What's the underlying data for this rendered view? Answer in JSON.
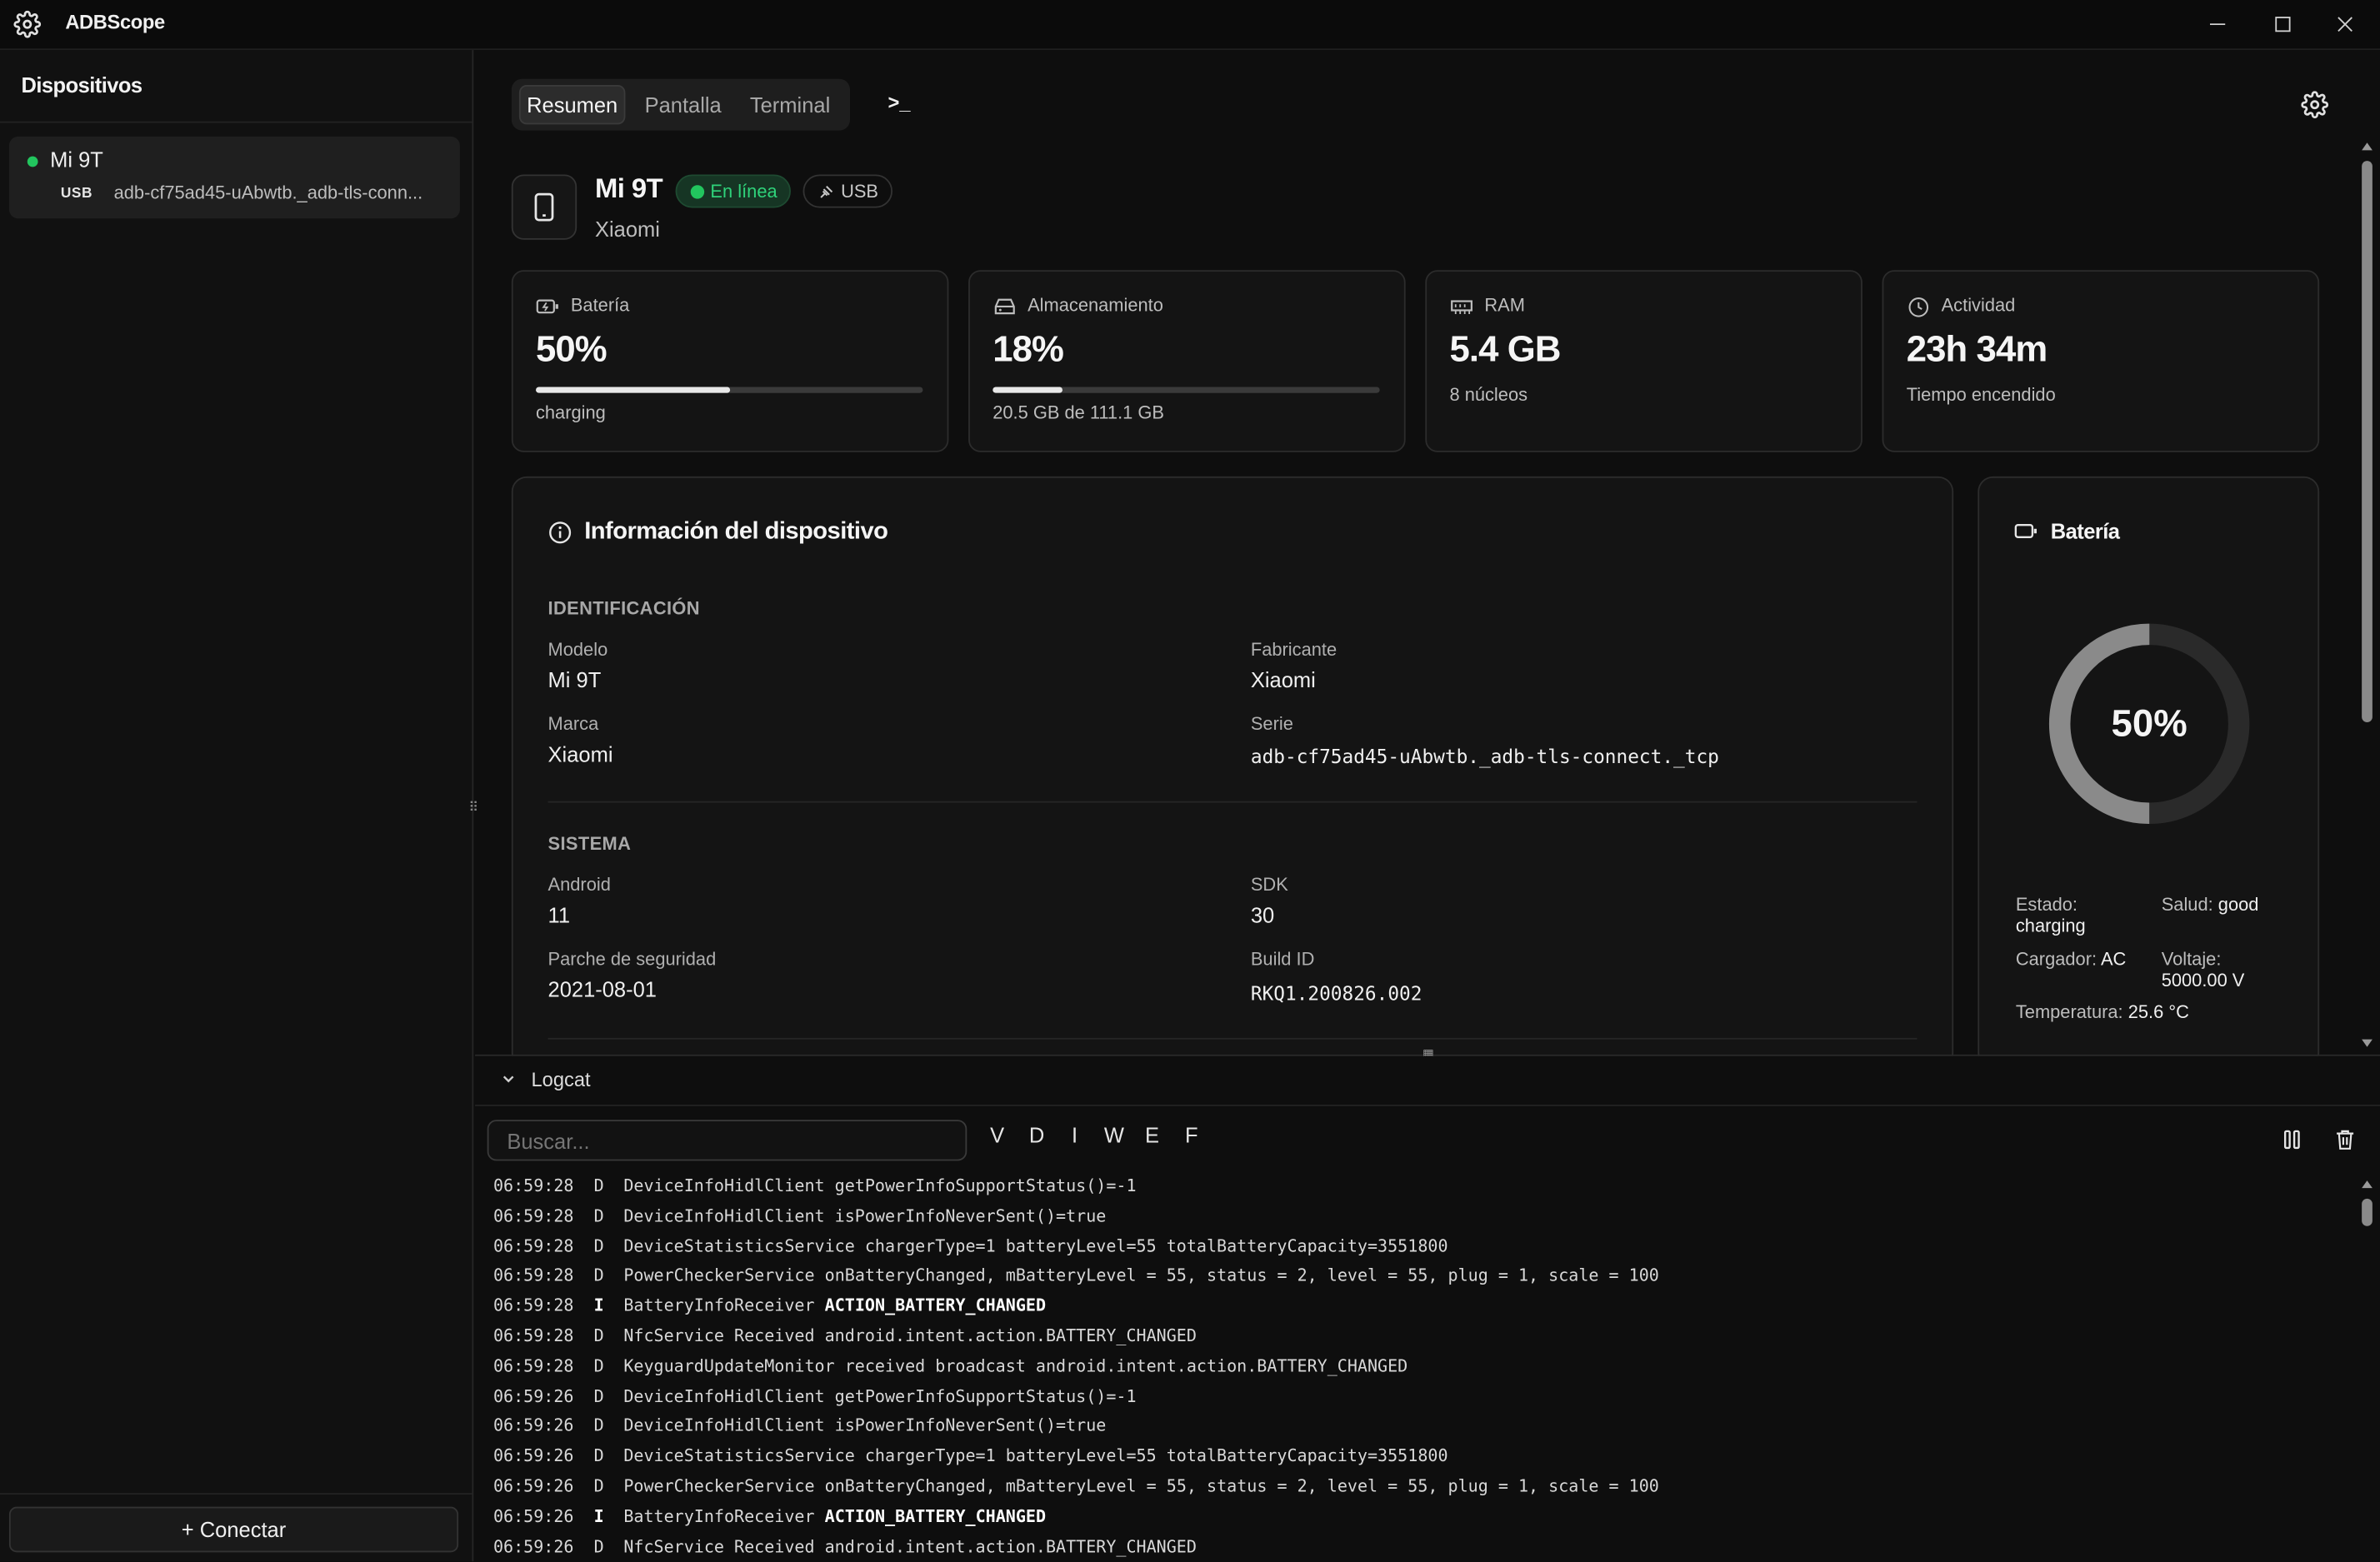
{
  "app": {
    "title": "ADBScope"
  },
  "sidebar": {
    "title": "Dispositivos",
    "device": {
      "name": "Mi 9T",
      "conn": "USB",
      "serial": "adb-cf75ad45-uAbwtb._adb-tls-conn..."
    },
    "connect_label": "+ Conectar"
  },
  "tabs": [
    "Resumen",
    "Pantalla",
    "Terminal"
  ],
  "terminal_glyph": ">_",
  "device": {
    "name": "Mi 9T",
    "status": "En línea",
    "conn": "USB",
    "brand": "Xiaomi"
  },
  "stats": {
    "battery": {
      "label": "Batería",
      "value": "50%",
      "fraction": 0.5,
      "sub": "charging"
    },
    "storage": {
      "label": "Almacenamiento",
      "value": "18%",
      "fraction": 0.18,
      "sub": "20.5 GB de 111.1 GB"
    },
    "ram": {
      "label": "RAM",
      "value": "5.4 GB",
      "sub": "8 núcleos"
    },
    "activity": {
      "label": "Actividad",
      "value": "23h 34m",
      "sub": "Tiempo encendido"
    }
  },
  "info": {
    "title": "Información del dispositivo",
    "ident_title": "IDENTIFICACIÓN",
    "model_label": "Modelo",
    "model": "Mi 9T",
    "maker_label": "Fabricante",
    "maker": "Xiaomi",
    "brand_label": "Marca",
    "brand": "Xiaomi",
    "serial_label": "Serie",
    "serial": "adb-cf75ad45-uAbwtb._adb-tls-connect._tcp",
    "system_title": "SISTEMA",
    "android_label": "Android",
    "android": "11",
    "sdk_label": "SDK",
    "sdk": "30",
    "patch_label": "Parche de seguridad",
    "patch": "2021-08-01",
    "build_label": "Build ID",
    "build": "RKQ1.200826.002"
  },
  "battery_panel": {
    "title": "Batería",
    "percent": "50%",
    "level": 0.5,
    "state_label": "Estado:",
    "state": "charging",
    "health_label": "Salud:",
    "health": "good",
    "charger_label": "Cargador:",
    "charger": "AC",
    "voltage_label": "Voltaje:",
    "voltage": "5000.00 V",
    "temp_label": "Temperatura:",
    "temp": "25.6 °C"
  },
  "logcat": {
    "title": "Logcat",
    "search_placeholder": "Buscar...",
    "levels": [
      "V",
      "D",
      "I",
      "W",
      "E",
      "F"
    ],
    "lines": [
      {
        "time": "06:59:28",
        "level": "D",
        "tag": "DeviceInfoHidlClient",
        "msg": "getPowerInfoSupportStatus()=-1",
        "bold": false
      },
      {
        "time": "06:59:28",
        "level": "D",
        "tag": "DeviceInfoHidlClient",
        "msg": "isPowerInfoNeverSent()=true",
        "bold": false
      },
      {
        "time": "06:59:28",
        "level": "D",
        "tag": "DeviceStatisticsService",
        "msg": "chargerType=1 batteryLevel=55 totalBatteryCapacity=3551800",
        "bold": false
      },
      {
        "time": "06:59:28",
        "level": "D",
        "tag": "PowerCheckerService",
        "msg": "onBatteryChanged, mBatteryLevel = 55, status = 2, level = 55, plug = 1, scale = 100",
        "bold": false
      },
      {
        "time": "06:59:28",
        "level": "I",
        "tag": "BatteryInfoReceiver",
        "msg": "ACTION_BATTERY_CHANGED",
        "bold": true
      },
      {
        "time": "06:59:28",
        "level": "D",
        "tag": "NfcService",
        "msg": "Received android.intent.action.BATTERY_CHANGED",
        "bold": false
      },
      {
        "time": "06:59:28",
        "level": "D",
        "tag": "KeyguardUpdateMonitor",
        "msg": "received broadcast android.intent.action.BATTERY_CHANGED",
        "bold": false
      },
      {
        "time": "06:59:26",
        "level": "D",
        "tag": "DeviceInfoHidlClient",
        "msg": "getPowerInfoSupportStatus()=-1",
        "bold": false
      },
      {
        "time": "06:59:26",
        "level": "D",
        "tag": "DeviceInfoHidlClient",
        "msg": "isPowerInfoNeverSent()=true",
        "bold": false
      },
      {
        "time": "06:59:26",
        "level": "D",
        "tag": "DeviceStatisticsService",
        "msg": "chargerType=1 batteryLevel=55 totalBatteryCapacity=3551800",
        "bold": false
      },
      {
        "time": "06:59:26",
        "level": "D",
        "tag": "PowerCheckerService",
        "msg": "onBatteryChanged, mBatteryLevel = 55, status = 2, level = 55, plug = 1, scale = 100",
        "bold": false
      },
      {
        "time": "06:59:26",
        "level": "I",
        "tag": "BatteryInfoReceiver",
        "msg": "ACTION_BATTERY_CHANGED",
        "bold": true
      },
      {
        "time": "06:59:26",
        "level": "D",
        "tag": "NfcService",
        "msg": "Received android.intent.action.BATTERY_CHANGED",
        "bold": false
      }
    ]
  },
  "colors": {
    "online": "#22c55e",
    "accent_bg": "#0e0e0e"
  }
}
